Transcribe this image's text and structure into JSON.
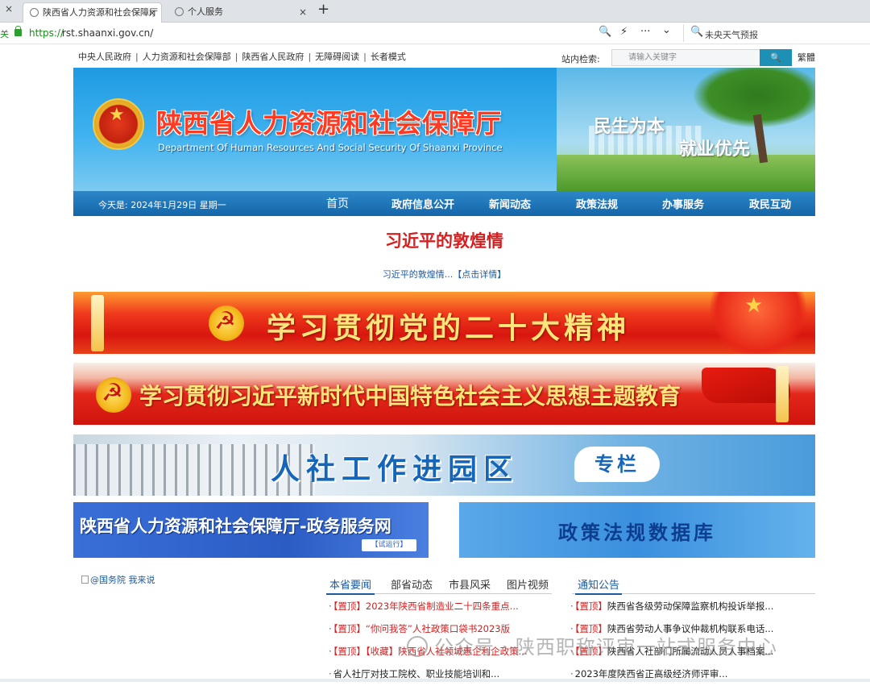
{
  "browser": {
    "tabs": [
      {
        "title": "陕西省人力资源和社会保障厅",
        "active": true
      },
      {
        "title": "个人服务",
        "active": false
      }
    ],
    "close_glyph": "×",
    "new_tab_glyph": "+",
    "address": {
      "left_text": "关",
      "scheme": "https://",
      "url": "rst.shaanxi.gov.cn/"
    },
    "toolbar_glyphs": {
      "zoom": "🔍",
      "bolt": "⚡",
      "more": "···",
      "chevron": "⌄"
    },
    "search_ext": {
      "icon": "🔍",
      "text": "未央天气预报"
    }
  },
  "site": {
    "toplinks": [
      "中央人民政府",
      "人力资源和社会保障部",
      "陕西省人民政府",
      "无障碍阅读",
      "长者模式"
    ],
    "separator": "|",
    "search_label": "站内检索:",
    "search_placeholder": "请输入关键字",
    "search_button": "🔍",
    "traditional": "繁體",
    "header": {
      "title": "陕西省人力资源和社会保障厅",
      "subtitle": "Department Of Human Resources And Social Security Of Shaanxi Province",
      "slogan1": "民生为本",
      "slogan2": "就业优先"
    },
    "nav": {
      "date": "今天是:  2024年1月29日 星期一",
      "items": [
        "首页",
        "政府信息公开",
        "新闻动态",
        "政策法规",
        "办事服务",
        "政民互动"
      ]
    },
    "headline": {
      "title": "习近平的敦煌情",
      "link": "习近平的敦煌情...【点击详情】"
    },
    "banners": {
      "study_spirit": "学习贯彻党的二十大精神",
      "study_thought": "学习贯彻习近平新时代中国特色社会主义思想主题教育",
      "park_title": "人社工作进园区",
      "park_tag": "专栏",
      "service_net": "陕西省人力资源和社会保障厅-政务服务网",
      "service_trial": "【试运行】",
      "policy_db": "政策法规数据库"
    },
    "gwy": "@国务院 我来说",
    "news_tabs": [
      "本省要闻",
      "部省动态",
      "市县风采",
      "图片视频"
    ],
    "notice_tab": "通知公告",
    "news_left": [
      {
        "pin": "【置顶】",
        "text": "2023年陕西省制造业二十四条重点...",
        "red": true
      },
      {
        "pin": "【置顶】",
        "text": "“你问我答”人社政策口袋书2023版",
        "red": true
      },
      {
        "pin": "【置顶】【收藏】",
        "text": "陕西省人社领域惠企利企政策...",
        "red": true
      },
      {
        "pin": "",
        "text": "省人社厅对技工院校、职业技能培训和...",
        "red": false
      }
    ],
    "news_right": [
      {
        "pin": "【置顶】",
        "text": "陕西省各级劳动保障监察机构投诉举报..."
      },
      {
        "pin": "【置顶】",
        "text": "陕西省劳动人事争议仲裁机构联系电话..."
      },
      {
        "pin": "【置顶】",
        "text": "陕西省人社部门所属流动人员人事档案..."
      },
      {
        "pin": "",
        "text": "2023年度陕西省正高级经济师评审..."
      }
    ],
    "watermark": "公众号 · 陕西职称评审一站式服务中心"
  }
}
